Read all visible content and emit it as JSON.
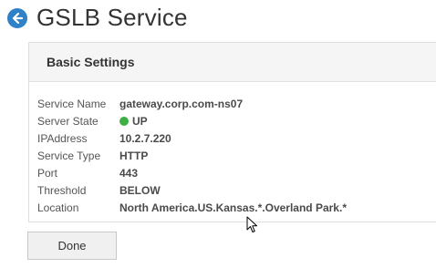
{
  "header": {
    "title": "GSLB Service",
    "back_icon": "back-arrow-icon"
  },
  "panel": {
    "title": "Basic Settings",
    "rows": [
      {
        "label": "Service Name",
        "value": "gateway.corp.com-ns07"
      },
      {
        "label": "Server State",
        "value": "UP",
        "status_color": "#3cb043"
      },
      {
        "label": "IPAddress",
        "value": "10.2.7.220"
      },
      {
        "label": "Service Type",
        "value": "HTTP"
      },
      {
        "label": "Port",
        "value": "443"
      },
      {
        "label": "Threshold",
        "value": "BELOW"
      },
      {
        "label": "Location",
        "value": "North America.US.Kansas.*.Overland Park.*"
      }
    ]
  },
  "footer": {
    "done_label": "Done"
  },
  "colors": {
    "accent": "#2f82c8",
    "status_up": "#3cb043"
  }
}
